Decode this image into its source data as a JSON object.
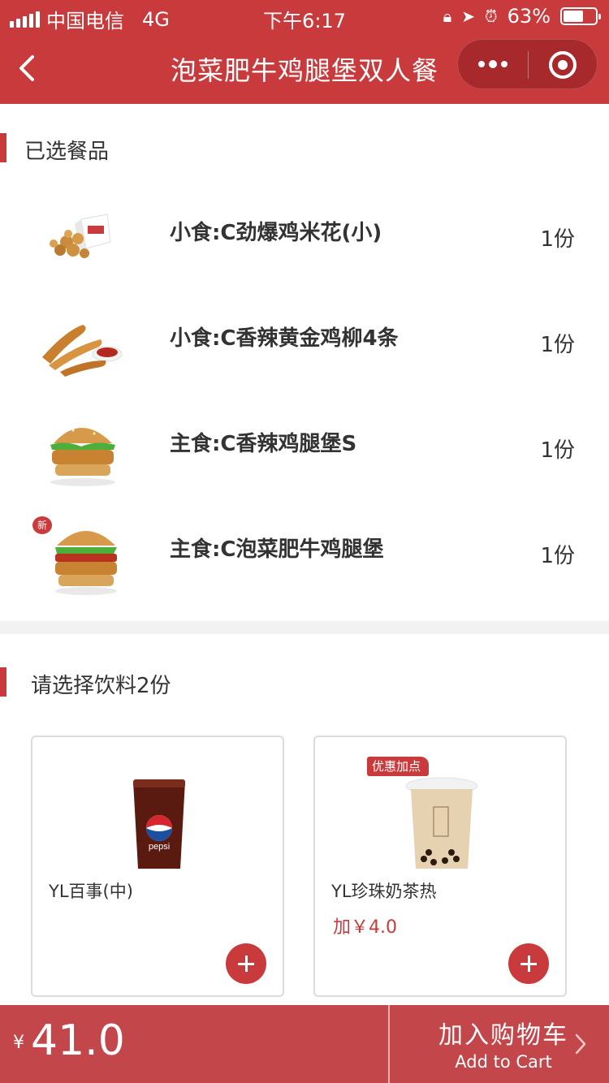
{
  "status_bar": {
    "carrier": "中国电信",
    "network": "4G",
    "time": "下午6:17",
    "battery_percent": "63%",
    "battery_level": 0.63
  },
  "nav": {
    "title": "泡菜肥牛鸡腿堡双人餐"
  },
  "selected_section": {
    "title": "已选餐品",
    "items": [
      {
        "name": "小食:C劲爆鸡米花(小)",
        "qty": "1份",
        "icon": "popcorn-chicken-image"
      },
      {
        "name": "小食:C香辣黄金鸡柳4条",
        "qty": "1份",
        "icon": "chicken-strips-image"
      },
      {
        "name": "主食:C香辣鸡腿堡S",
        "qty": "1份",
        "icon": "spicy-burger-image"
      },
      {
        "name": "主食:C泡菜肥牛鸡腿堡",
        "qty": "1份",
        "icon": "kimchi-beef-burger-image",
        "badge": "新"
      }
    ]
  },
  "drink_section": {
    "title": "请选择饮料2份",
    "cards": [
      {
        "name": "YL百事(中)",
        "price": "",
        "icon": "pepsi-cup-image"
      },
      {
        "name": "YL珍珠奶茶热",
        "price": "加￥4.0",
        "badge": "优惠加点",
        "icon": "milk-tea-cup-image"
      }
    ]
  },
  "bottom_bar": {
    "currency": "¥",
    "total": "41.0",
    "cart_label_cn": "加入购物车",
    "cart_label_en": "Add to Cart"
  },
  "colors": {
    "brand_red": "#c93a3c",
    "bottom_bar": "#c2464a"
  }
}
